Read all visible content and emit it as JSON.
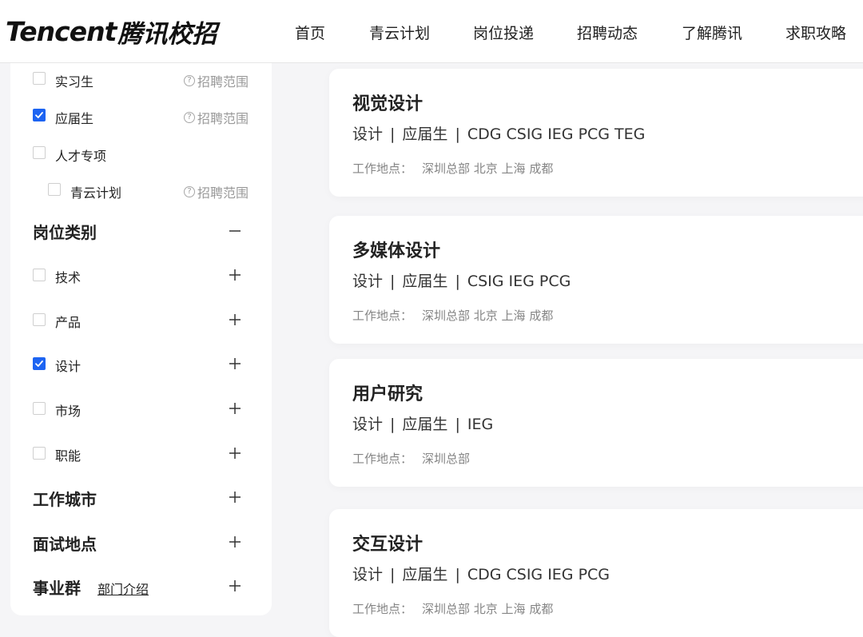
{
  "header": {
    "logo_brand": "Tencent",
    "logo_cn": "腾讯校招",
    "nav": [
      "首页",
      "青云计划",
      "岗位投递",
      "招聘动态",
      "了解腾讯",
      "求职攻略"
    ]
  },
  "sidebar": {
    "recruit_types": [
      {
        "label": "实习生",
        "checked": false,
        "scope": "招聘范围"
      },
      {
        "label": "应届生",
        "checked": true,
        "scope": "招聘范围"
      },
      {
        "label": "人才专项",
        "checked": false,
        "scope": ""
      },
      {
        "label": "青云计划",
        "checked": false,
        "scope": "招聘范围"
      }
    ],
    "job_category": {
      "title": "岗位类别",
      "items": [
        {
          "label": "技术",
          "checked": false
        },
        {
          "label": "产品",
          "checked": false
        },
        {
          "label": "设计",
          "checked": true
        },
        {
          "label": "市场",
          "checked": false
        },
        {
          "label": "职能",
          "checked": false
        }
      ]
    },
    "work_city": {
      "title": "工作城市"
    },
    "interview_location": {
      "title": "面试地点"
    },
    "business_group": {
      "title": "事业群",
      "link": "部门介绍"
    }
  },
  "jobs": [
    {
      "title": "视觉设计",
      "category": "设计",
      "type": "应届生",
      "groups": "CDG CSIG IEG PCG TEG",
      "location_label": "工作地点：",
      "locations": "深圳总部 北京 上海 成都"
    },
    {
      "title": "多媒体设计",
      "category": "设计",
      "type": "应届生",
      "groups": "CSIG IEG PCG",
      "location_label": "工作地点：",
      "locations": "深圳总部 北京 上海 成都"
    },
    {
      "title": "用户研究",
      "category": "设计",
      "type": "应届生",
      "groups": "IEG",
      "location_label": "工作地点：",
      "locations": "深圳总部"
    },
    {
      "title": "交互设计",
      "category": "设计",
      "type": "应届生",
      "groups": "CDG CSIG IEG PCG",
      "location_label": "工作地点：",
      "locations": "深圳总部 北京 上海 成都"
    }
  ],
  "colors": {
    "accent": "#1d64f2",
    "page_bg": "#f5f5f7",
    "muted_text": "#858585"
  }
}
